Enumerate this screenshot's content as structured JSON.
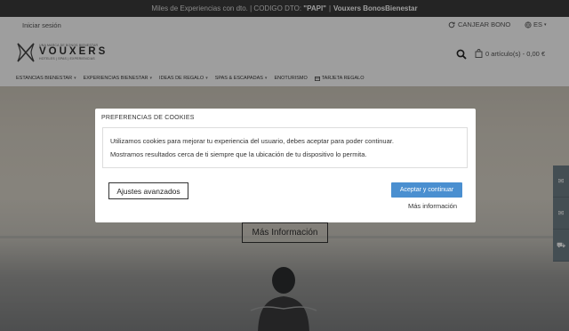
{
  "promo": {
    "text_start": "Miles de Experiencias con dto. | CODIGO DTO:",
    "code": "\"PAPI\"",
    "separator": "|",
    "brand_text": "Vouxers BonosBienestar"
  },
  "header": {
    "login": "Iniciar sesión",
    "redeem": "CANJEAR BONO",
    "lang": "ES",
    "cart": "0 artículo(s) - 0,00 €",
    "logo": {
      "tagline": "UNA MARCA DE BONOS BIENESTAR",
      "name": "VOUXERS",
      "subline": "HOTELES | SPAS | EXPERIENCIAS"
    }
  },
  "nav": [
    {
      "label": "ESTANCIAS BIENESTAR",
      "has_menu": true,
      "icon": ""
    },
    {
      "label": "EXPERIENCIAS BIENESTAR",
      "has_menu": true,
      "icon": ""
    },
    {
      "label": "IDEAS DE REGALO",
      "has_menu": true,
      "icon": ""
    },
    {
      "label": "SPAS & ESCAPADAS",
      "has_menu": true,
      "icon": ""
    },
    {
      "label": "ENOTURISMO",
      "has_menu": false,
      "icon": ""
    },
    {
      "label": "TARJETA REGALO",
      "has_menu": false,
      "icon": "gift-card-icon"
    }
  ],
  "hero": {
    "more_info": "Más Información"
  },
  "side_tabs": [
    "chat-icon",
    "mail-icon",
    "cart-icon"
  ],
  "cookie_modal": {
    "title": "PREFERENCIAS DE COOKIES",
    "paragraph1": "Utilizamos cookies para mejorar tu experiencia del usuario, debes aceptar para poder continuar.",
    "paragraph2": "Mostramos resultados cerca de ti siempre que la ubicación de tu dispositivo lo permita.",
    "advanced_button": "Ajustes avanzados",
    "accept_button": "Aceptar y continuar",
    "more_link": "Más información"
  },
  "colors": {
    "accent": "#4a8fd0",
    "promo_bg": "#3b3b3b",
    "side_tab_bg": "#6e7f87"
  }
}
